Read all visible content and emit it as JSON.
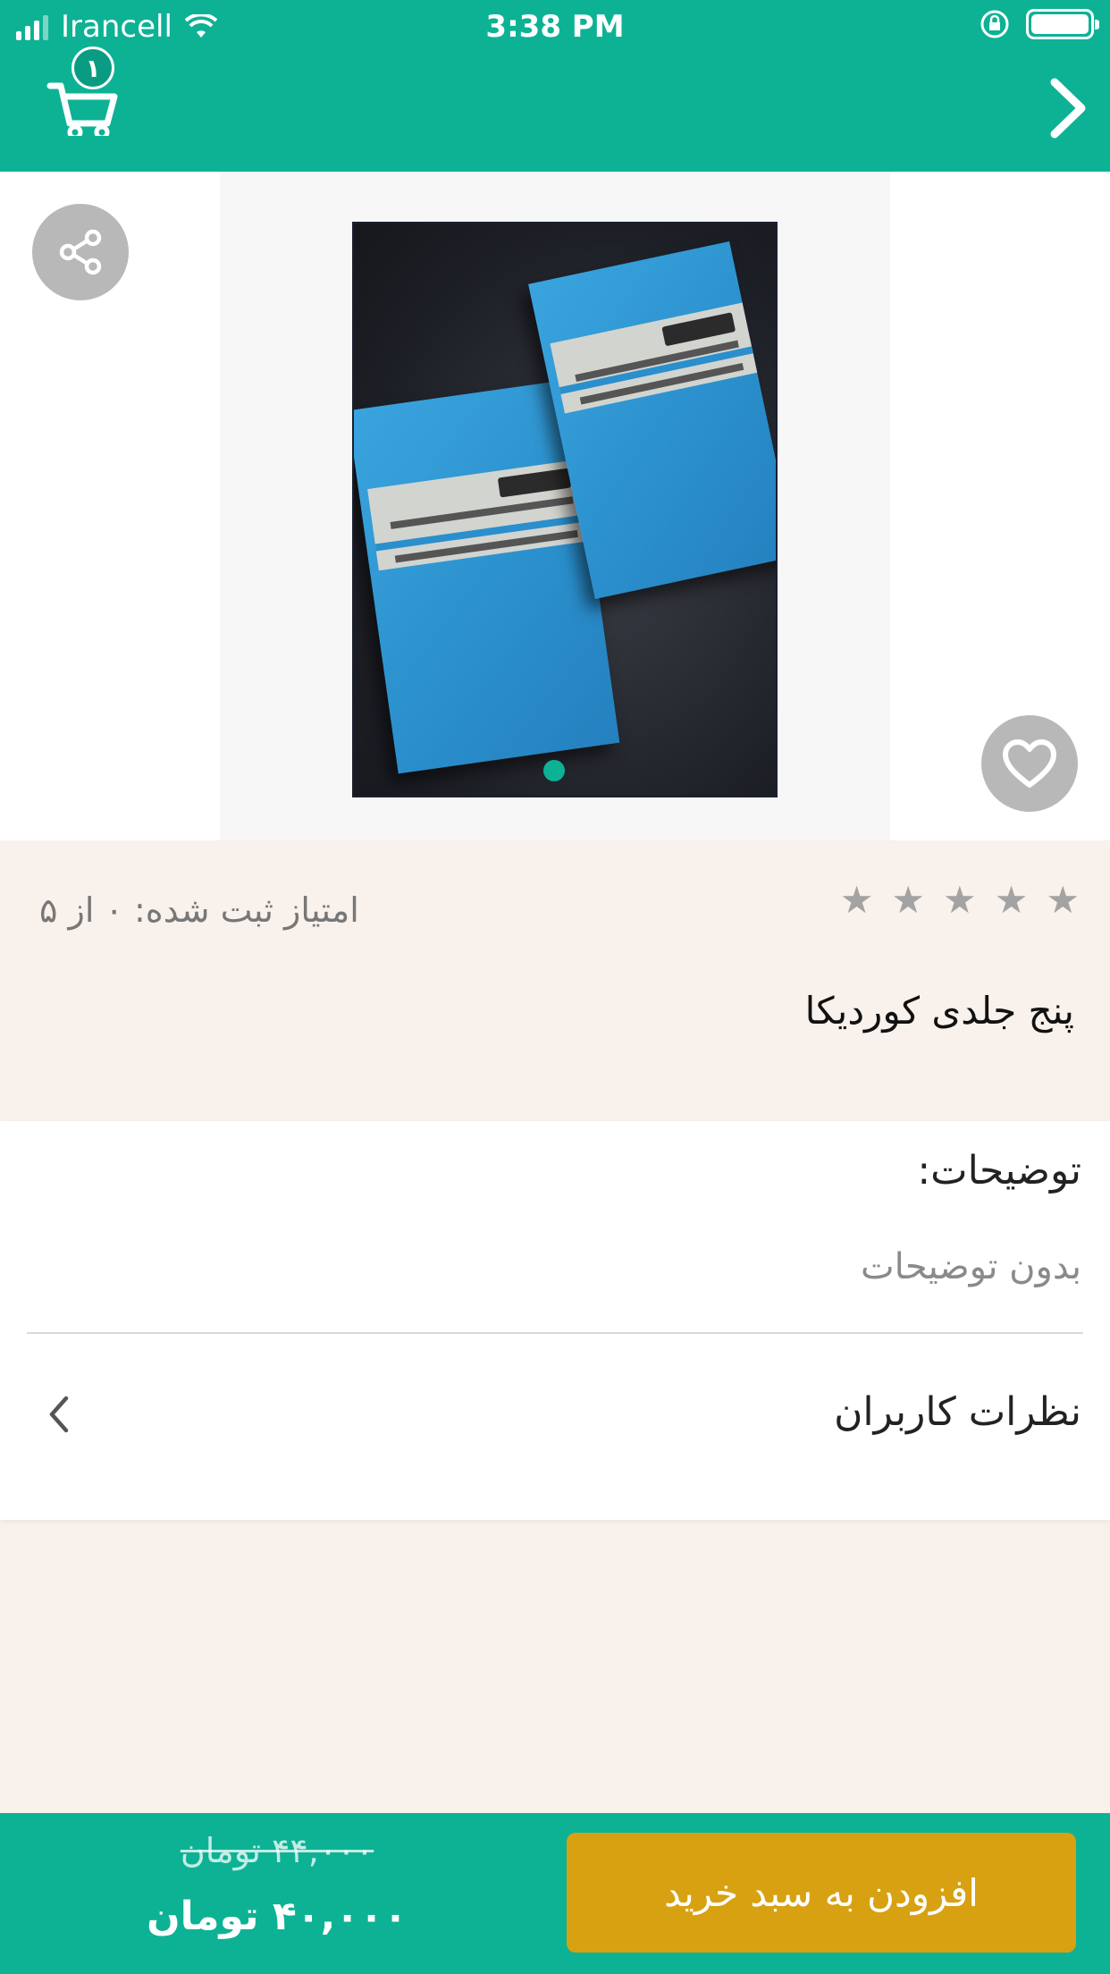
{
  "status_bar": {
    "carrier": "Irancell",
    "time": "3:38 PM"
  },
  "header": {
    "cart_count": "۱",
    "cart_icon": "cart-icon",
    "back_icon": "chevron-right-icon"
  },
  "gallery": {
    "share_icon": "share-icon",
    "favorite_icon": "heart-icon",
    "image_alt": "book cover"
  },
  "product": {
    "rating_text": "امتیاز ثبت شده: ۰ از ۵",
    "stars_count": 5,
    "stars_filled": 0,
    "title": "پنج جلدی کوردیکا"
  },
  "description": {
    "heading": "توضیحات:",
    "body": "بدون توضیحات",
    "reviews_label": "نظرات کاربران"
  },
  "bottom_bar": {
    "old_price": "۴۴,۰۰۰ تومان",
    "new_price": "۴۰,۰۰۰ تومان",
    "add_to_cart": "افزودن به سبد خرید"
  },
  "colors": {
    "primary": "#0db295",
    "accent": "#d7a111",
    "background": "#f8f1ec"
  }
}
